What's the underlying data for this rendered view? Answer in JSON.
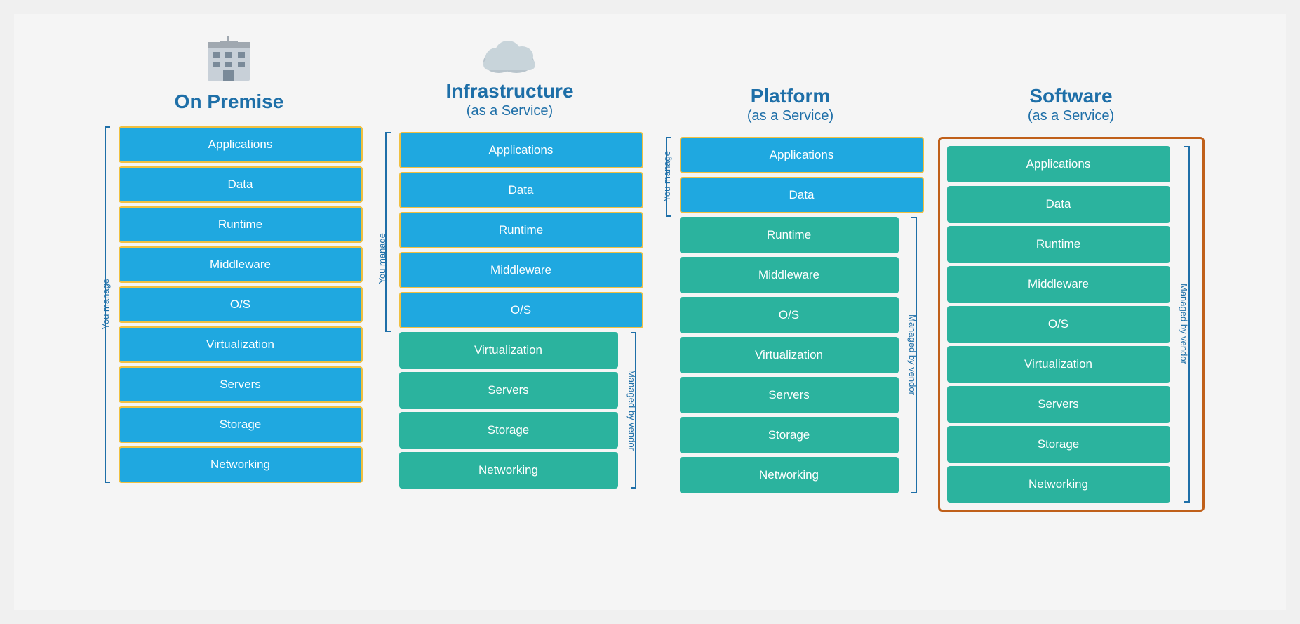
{
  "columns": [
    {
      "id": "on-premise",
      "title": "On Premise",
      "subtitle": "",
      "iconType": "building",
      "you_manage_tiles": [
        "Applications",
        "Data",
        "Runtime",
        "Middleware",
        "O/S",
        "Virtualization",
        "Servers",
        "Storage",
        "Networking"
      ],
      "you_manage_label": "You manage",
      "vendor_manage_label": "",
      "you_manage_count": 9,
      "vendor_manage_count": 0,
      "tile_colors": [
        "blue",
        "blue",
        "blue",
        "blue",
        "blue",
        "blue",
        "blue",
        "blue",
        "blue"
      ]
    },
    {
      "id": "infrastructure",
      "title": "Infrastructure",
      "subtitle": "(as a Service)",
      "iconType": "cloud",
      "you_manage_tiles": [
        "Applications",
        "Data",
        "Runtime",
        "Middleware",
        "O/S"
      ],
      "vendor_manage_tiles": [
        "Virtualization",
        "Servers",
        "Storage",
        "Networking"
      ],
      "you_manage_label": "You manage",
      "vendor_manage_label": "Managed by vendor",
      "you_manage_count": 5,
      "vendor_manage_count": 4,
      "you_tile_colors": [
        "blue",
        "blue",
        "blue",
        "blue",
        "blue"
      ],
      "vendor_tile_colors": [
        "green",
        "green",
        "green",
        "green"
      ]
    },
    {
      "id": "platform",
      "title": "Platform",
      "subtitle": "(as a Service)",
      "iconType": "none",
      "you_manage_tiles": [
        "Applications",
        "Data"
      ],
      "vendor_manage_tiles": [
        "Runtime",
        "Middleware",
        "O/S",
        "Virtualization",
        "Servers",
        "Storage",
        "Networking"
      ],
      "you_manage_label": "You manage",
      "vendor_manage_label": "Managed by vendor",
      "you_manage_count": 2,
      "vendor_manage_count": 7,
      "you_tile_colors": [
        "blue",
        "blue"
      ],
      "vendor_tile_colors": [
        "green",
        "green",
        "green",
        "green",
        "green",
        "green",
        "green"
      ]
    },
    {
      "id": "software",
      "title": "Software",
      "subtitle": "(as a Service)",
      "iconType": "none",
      "all_tiles": [
        "Applications",
        "Data",
        "Runtime",
        "Middleware",
        "O/S",
        "Virtualization",
        "Servers",
        "Storage",
        "Networking"
      ],
      "vendor_manage_label": "Managed by vendor",
      "tile_colors": [
        "green",
        "green",
        "green",
        "green",
        "green",
        "green",
        "green",
        "green",
        "green"
      ]
    }
  ]
}
